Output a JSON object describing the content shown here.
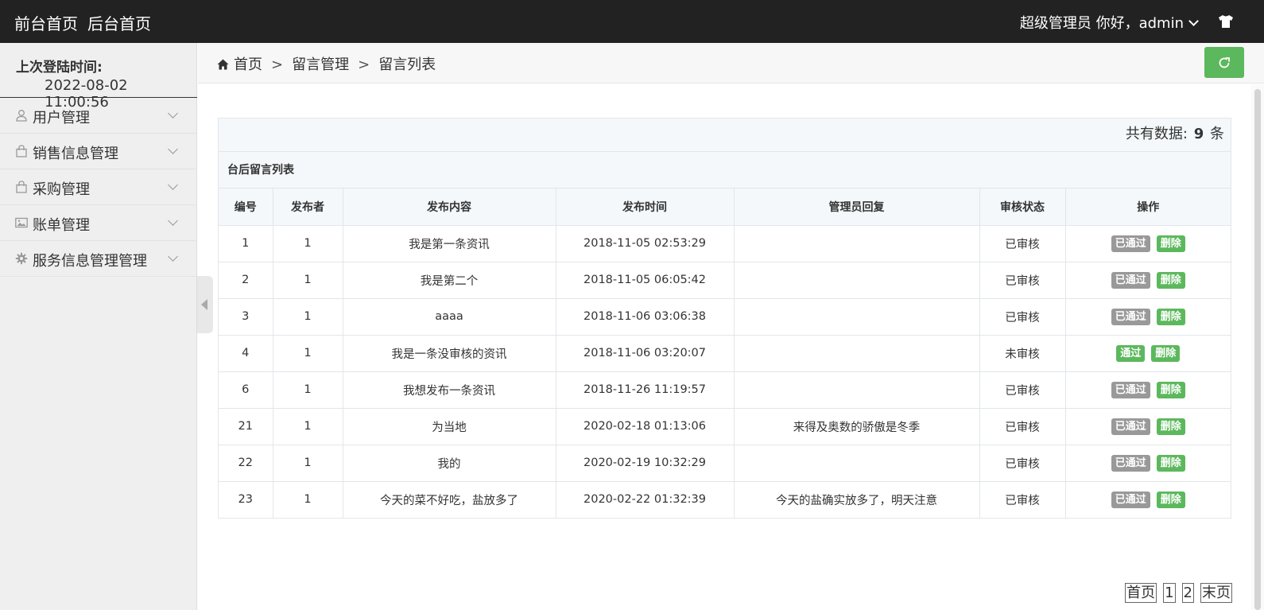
{
  "topbar": {
    "front_home": "前台首页",
    "back_home": "后台首页",
    "user_greeting": "超级管理员 你好，admin",
    "shirt_icon": "tshirt-icon"
  },
  "sidebar": {
    "login_label": "上次登陆时间:",
    "login_time": "2022-08-02 11:00:56",
    "items": [
      {
        "label": "用户管理",
        "icon": "user-icon"
      },
      {
        "label": "销售信息管理",
        "icon": "bag-icon"
      },
      {
        "label": "采购管理",
        "icon": "bag-icon"
      },
      {
        "label": "账单管理",
        "icon": "image-icon"
      },
      {
        "label": "服务信息管理管理",
        "icon": "gear-icon"
      }
    ]
  },
  "breadcrumb": {
    "home": "首页",
    "sep": ">",
    "level1": "留言管理",
    "level2": "留言列表"
  },
  "summary": {
    "prefix": "共有数据:",
    "count": "9",
    "suffix": "条"
  },
  "list_title": "台后留言列表",
  "table": {
    "headers": [
      "编号",
      "发布者",
      "发布内容",
      "发布时间",
      "管理员回复",
      "审核状态",
      "操作"
    ],
    "rows": [
      {
        "id": "1",
        "author": "1",
        "content": "我是第一条资讯",
        "time": "2018-11-05 02:53:29",
        "reply": "",
        "status": "已审核",
        "action1": "已通过",
        "action2": "删除"
      },
      {
        "id": "2",
        "author": "1",
        "content": "我是第二个",
        "time": "2018-11-05 06:05:42",
        "reply": "",
        "status": "已审核",
        "action1": "已通过",
        "action2": "删除"
      },
      {
        "id": "3",
        "author": "1",
        "content": "aaaa",
        "time": "2018-11-06 03:06:38",
        "reply": "",
        "status": "已审核",
        "action1": "已通过",
        "action2": "删除"
      },
      {
        "id": "4",
        "author": "1",
        "content": "我是一条没审核的资讯",
        "time": "2018-11-06 03:20:07",
        "reply": "",
        "status": "未审核",
        "action1": "通过",
        "action2": "删除"
      },
      {
        "id": "6",
        "author": "1",
        "content": "我想发布一条资讯",
        "time": "2018-11-26 11:19:57",
        "reply": "",
        "status": "已审核",
        "action1": "已通过",
        "action2": "删除"
      },
      {
        "id": "21",
        "author": "1",
        "content": "为当地",
        "time": "2020-02-18 01:13:06",
        "reply": "来得及奥数的骄傲是冬季",
        "status": "已审核",
        "action1": "已通过",
        "action2": "删除"
      },
      {
        "id": "22",
        "author": "1",
        "content": "我的",
        "time": "2020-02-19 10:32:29",
        "reply": "",
        "status": "已审核",
        "action1": "已通过",
        "action2": "删除"
      },
      {
        "id": "23",
        "author": "1",
        "content": "今天的菜不好吃，盐放多了",
        "time": "2020-02-22 01:32:39",
        "reply": "今天的盐确实放多了，明天注意",
        "status": "已审核",
        "action1": "已通过",
        "action2": "删除"
      }
    ]
  },
  "pager": {
    "first": "首页",
    "pages": [
      "1",
      "2"
    ],
    "last": "末页"
  },
  "colors": {
    "topbar_bg": "#222222",
    "accent_green": "#5cb85c",
    "passed_gray": "#999999"
  }
}
